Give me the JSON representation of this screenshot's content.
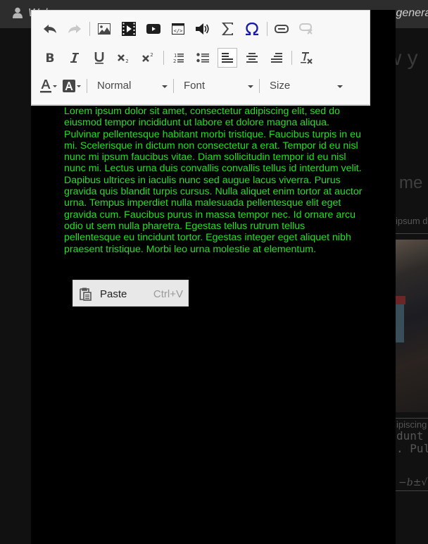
{
  "topbar": {
    "welcome_fragment": "Welcome, ...",
    "tail_fragment": "nger genera"
  },
  "background_page": {
    "heading_fragment": "ow y",
    "subheading_fragment": "me",
    "lorem_fragment": "ipsum d",
    "text_fragment_1": "ipiscing",
    "text_fragment_2": "dunt",
    "text_fragment_3": ". Pulv",
    "formula_fragment": "−b±√"
  },
  "toolbar": {
    "row1": [
      {
        "name": "undo",
        "icon": "undo-icon",
        "enabled": true
      },
      {
        "name": "redo",
        "icon": "redo-icon",
        "enabled": false
      },
      {
        "name": "image",
        "icon": "image-icon",
        "enabled": true
      },
      {
        "name": "video",
        "icon": "video-icon",
        "enabled": true
      },
      {
        "name": "youtube",
        "icon": "youtube-icon",
        "enabled": true
      },
      {
        "name": "embed",
        "icon": "embed-icon",
        "enabled": true
      },
      {
        "name": "audio",
        "icon": "audio-icon",
        "enabled": true
      },
      {
        "name": "math",
        "icon": "sigma-icon",
        "enabled": true
      },
      {
        "name": "special-char",
        "icon": "omega-icon",
        "enabled": true
      },
      {
        "name": "link",
        "icon": "link-icon",
        "enabled": true
      },
      {
        "name": "unlink",
        "icon": "unlink-icon",
        "enabled": false
      }
    ],
    "row2": [
      {
        "name": "bold",
        "icon": "bold-icon"
      },
      {
        "name": "italic",
        "icon": "italic-icon"
      },
      {
        "name": "underline",
        "icon": "underline-icon"
      },
      {
        "name": "subscript",
        "icon": "subscript-icon"
      },
      {
        "name": "superscript",
        "icon": "superscript-icon"
      },
      {
        "name": "numbered-list",
        "icon": "numbered-list-icon"
      },
      {
        "name": "bulleted-list",
        "icon": "bulleted-list-icon"
      },
      {
        "name": "align-left",
        "icon": "align-left-icon",
        "active": true
      },
      {
        "name": "align-center",
        "icon": "align-center-icon"
      },
      {
        "name": "align-right",
        "icon": "align-right-icon"
      },
      {
        "name": "remove-format",
        "icon": "remove-format-icon"
      }
    ],
    "format_select": "Normal",
    "font_select": "Font",
    "size_select": "Size"
  },
  "editor": {
    "text_color": "#22e022",
    "background_color": "#000000",
    "content": "Lorem ipsum dolor sit amet, consectetur adipiscing elit, sed do eiusmod tempor incididunt ut labore et dolore magna aliqua. Pulvinar pellentesque habitant morbi tristique. Faucibus turpis in eu mi. Scelerisque in dictum non consectetur a erat. Tempor id eu nisl nunc mi ipsum faucibus vitae. Diam sollicitudin tempor id eu nisl nunc mi. Lectus urna duis convallis convallis tellus id interdum velit. Dapibus ultrices in iaculis nunc sed augue lacus viverra. Purus gravida quis blandit turpis cursus. Nulla aliquet enim tortor at auctor urna. Tempus imperdiet nulla malesuada pellentesque elit eget gravida cum. Faucibus purus in massa tempor nec. Id ornare arcu odio ut sem nulla pharetra. Egestas tellus rutrum tellus pellentesque eu tincidunt tortor. Egestas integer eget aliquet nibh praesent tristique. Morbi leo urna molestie at elementum."
  },
  "context_menu": {
    "items": [
      {
        "label": "Paste",
        "shortcut": "Ctrl+V",
        "icon": "paste-icon"
      }
    ]
  }
}
